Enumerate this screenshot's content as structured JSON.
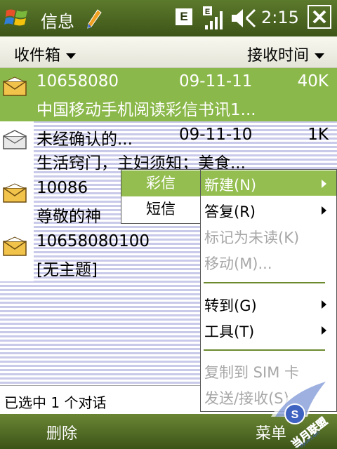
{
  "titlebar": {
    "title": "信息",
    "clock": "2:15",
    "network_letter": "E"
  },
  "header": {
    "folder": "收件箱",
    "sort": "接收时间"
  },
  "messages": [
    {
      "sender": "10658080",
      "date": "09-11-11",
      "size": "40K",
      "subject": "中国移动手机阅读彩信书讯1...",
      "selected": true
    },
    {
      "sender": "未经确认的...",
      "date": "09-11-10",
      "size": "1K",
      "subject": "生活窍门，主妇须知；美食...",
      "selected": false
    },
    {
      "sender": "10086",
      "date": "",
      "size": "",
      "subject": "尊敬的神",
      "selected": false
    },
    {
      "sender": "10658080100",
      "date": "",
      "size": "",
      "subject": "[无主题]",
      "selected": false
    }
  ],
  "status": "已选中 1 个对话",
  "softkeys": {
    "left": "删除",
    "right": "菜单"
  },
  "menu": {
    "items": [
      {
        "label": "新建(N)",
        "submenu": true,
        "disabled": false,
        "highlighted": true
      },
      {
        "label": "答复(R)",
        "submenu": true,
        "disabled": false,
        "highlighted": false
      },
      {
        "label": "标记为未读(K)",
        "submenu": false,
        "disabled": true,
        "highlighted": false
      },
      {
        "label": "移动(M)...",
        "submenu": false,
        "disabled": true,
        "highlighted": false
      },
      {
        "label": "转到(G)",
        "submenu": true,
        "disabled": false,
        "highlighted": false
      },
      {
        "label": "工具(T)",
        "submenu": true,
        "disabled": false,
        "highlighted": false
      },
      {
        "label": "复制到 SIM 卡",
        "submenu": false,
        "disabled": true,
        "highlighted": false
      },
      {
        "label": "发送/接收(S)",
        "submenu": false,
        "disabled": true,
        "highlighted": false
      }
    ]
  },
  "submenu": {
    "items": [
      {
        "label": "彩信",
        "highlighted": true
      },
      {
        "label": "短信",
        "highlighted": false
      }
    ]
  },
  "watermark": {
    "text": "当月联盟",
    "url": "www.dyue.com"
  },
  "colors": {
    "accent": "#8bb84a",
    "titlebar": "#4a6420",
    "stripe": "#c9c9ea",
    "menu_highlight": "#94be4f"
  }
}
